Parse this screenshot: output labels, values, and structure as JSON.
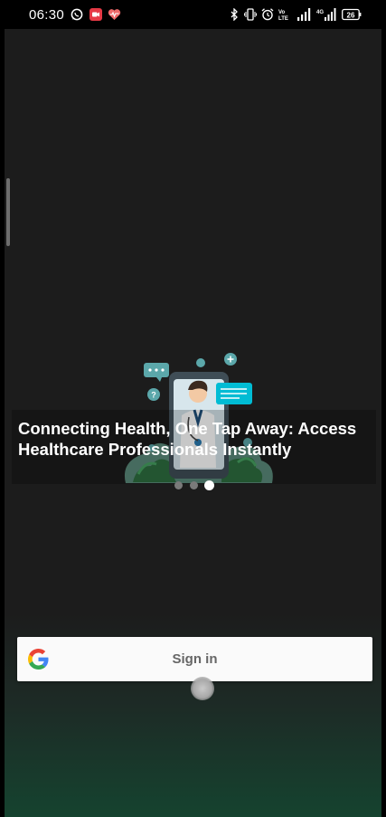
{
  "status_bar": {
    "time": "06:30",
    "battery": "26",
    "notification_icons": [
      "whatsapp-icon",
      "screen-recorder-icon",
      "health-icon"
    ],
    "system_icons": [
      "bluetooth-icon",
      "vibrate-icon",
      "alarm-icon",
      "volte-icon",
      "signal-icon",
      "signal-4g-icon",
      "battery-icon"
    ],
    "volte_label": "Vo LTE",
    "network_label": "4G"
  },
  "onboarding": {
    "caption": "Connecting Health, One Tap Away: Access Healthcare Professionals Instantly",
    "page_count": 3,
    "active_page": 3
  },
  "signin_button": {
    "label": "Sign in",
    "icon": "google-logo-icon"
  },
  "colors": {
    "background": "#1c1c1c",
    "bottom_glow": "#15432f",
    "chat_bubble": "#00bcd4",
    "button_bg": "#fafafa"
  }
}
